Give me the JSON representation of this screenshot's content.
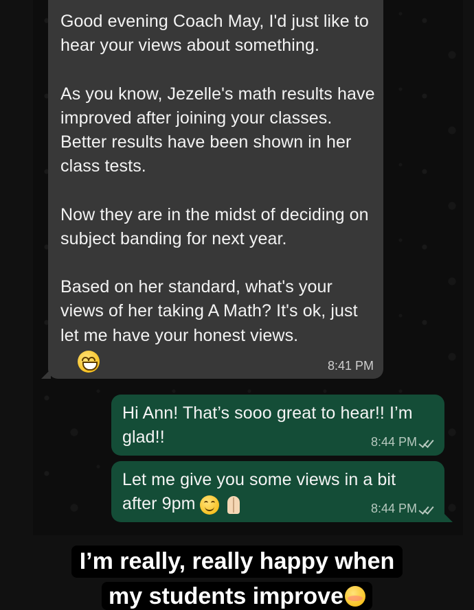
{
  "incoming": {
    "text": "Good evening Coach May, I'd just like to hear your views about something.\n\nAs you know, Jezelle's math results have improved after joining your classes. Better results have been shown in her class tests.\n\nNow they are in the midst of deciding on subject banding for next year.\n\nBased on her standard, what's your views of her taking A Math? It's ok, just let me have your honest views.",
    "emoji": "grinning-face",
    "time": "8:41 PM"
  },
  "outgoing": [
    {
      "text": "Hi Ann! That’s sooo great to hear!! I’m glad!!",
      "time": "8:44 PM",
      "status": "read-double-tick"
    },
    {
      "text": "Let me give you some views in a bit after 9pm",
      "emojis": [
        "smiling-face",
        "folded-hands"
      ],
      "time": "8:44 PM",
      "status": "read-double-tick"
    }
  ],
  "caption": {
    "line1": "I’m really, really happy when",
    "line2": "my students improve",
    "emoji": "relieved-face"
  },
  "colors": {
    "incoming_bubble": "#383838",
    "outgoing_bubble": "#144d37",
    "background": "#0d0d0d"
  }
}
